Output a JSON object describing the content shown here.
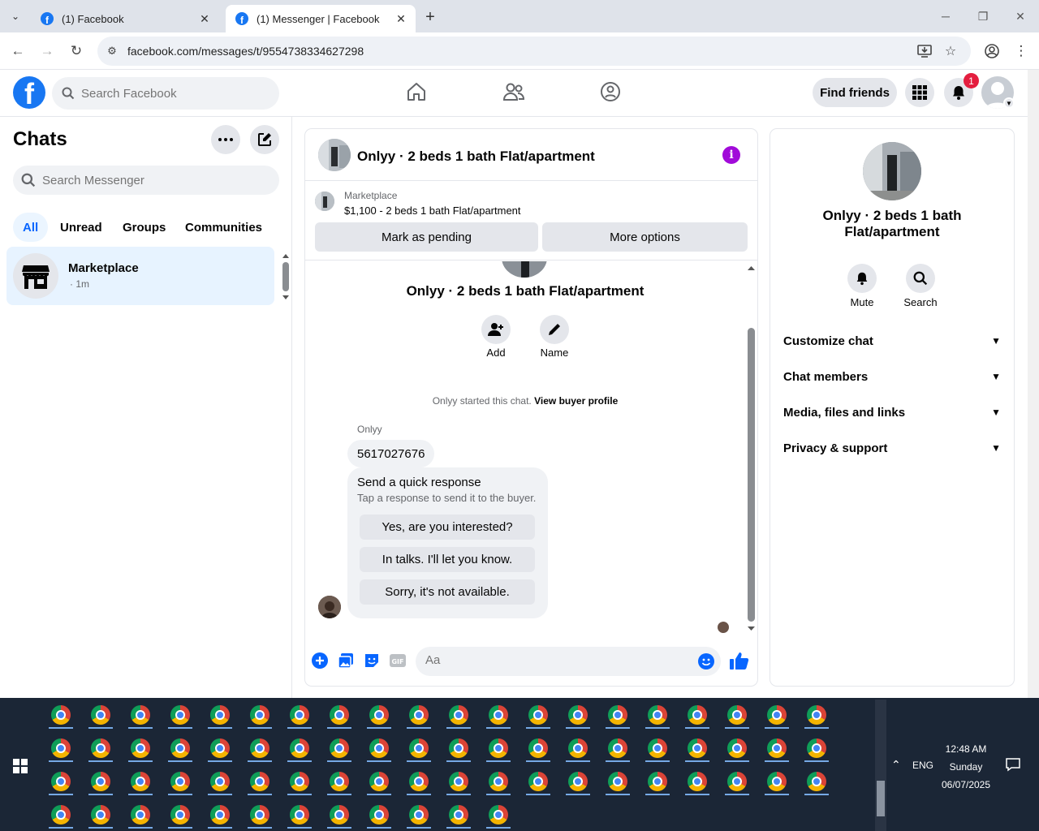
{
  "browser": {
    "tabs": [
      {
        "title": "(1) Facebook",
        "active": false
      },
      {
        "title": "(1) Messenger | Facebook",
        "active": true
      }
    ],
    "url": "facebook.com/messages/t/9554738334627298"
  },
  "header": {
    "search_placeholder": "Search Facebook",
    "find_friends": "Find friends",
    "notification_count": "1"
  },
  "sidebar": {
    "title": "Chats",
    "search_placeholder": "Search Messenger",
    "filters": [
      "All",
      "Unread",
      "Groups",
      "Communities"
    ],
    "active_filter": "All",
    "chats": [
      {
        "name": "Marketplace",
        "time": "· 1m"
      }
    ]
  },
  "chat": {
    "title": "Onlyy · 2 beds 1 bath Flat/apartment",
    "marketplace_label": "Marketplace",
    "listing": "$1,100 - 2 beds 1 bath Flat/apartment",
    "mark_pending": "Mark as pending",
    "more_options": "More options",
    "conversation_title": "Onlyy · 2 beds 1 bath Flat/apartment",
    "actions": [
      {
        "label": "Add",
        "icon": "add-person-icon"
      },
      {
        "label": "Name",
        "icon": "pencil-icon"
      }
    ],
    "started_text": "Onlyy started this chat.",
    "view_profile": "View buyer profile",
    "sender": "Onlyy",
    "message": "5617027676",
    "quick_title": "Send a quick response",
    "quick_sub": "Tap a response to send it to the buyer.",
    "quick_responses": [
      "Yes, are you interested?",
      "In talks. I'll let you know.",
      "Sorry, it's not available."
    ],
    "composer_placeholder": "Aa"
  },
  "info_panel": {
    "title": "Onlyy · 2 beds 1 bath Flat/apartment",
    "actions": [
      {
        "label": "Mute",
        "icon": "bell-icon"
      },
      {
        "label": "Search",
        "icon": "search-icon"
      }
    ],
    "sections": [
      "Customize chat",
      "Chat members",
      "Media, files and links",
      "Privacy & support"
    ]
  },
  "taskbar": {
    "time": "12:48 AM",
    "day": "Sunday",
    "date": "06/07/2025",
    "lang": "ENG"
  },
  "colors": {
    "brand": "#1877f2",
    "accent": "#0866ff",
    "info": "#a10bd9",
    "badge": "#e41e3f"
  }
}
